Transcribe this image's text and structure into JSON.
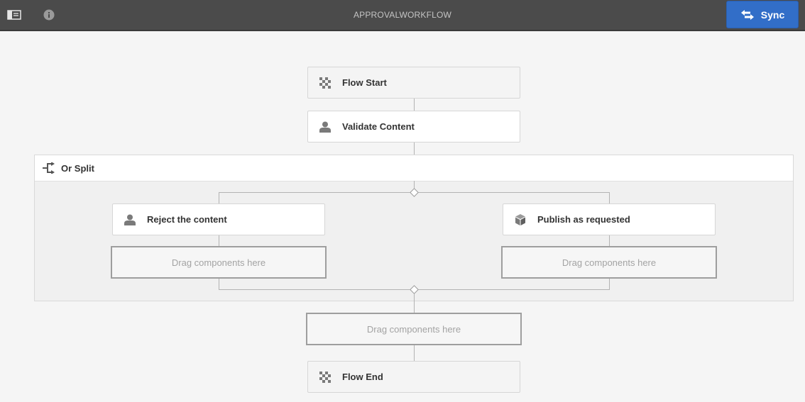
{
  "toolbar": {
    "title": "APPROVALWORKFLOW",
    "sync_label": "Sync",
    "accent_color": "#326ec8"
  },
  "icons": {
    "panel_toggle": "sidebar-toggle-icon",
    "info": "info-icon",
    "sync": "sync-arrows-icon",
    "flow_terminal": "checkered-flag-icon",
    "participant": "user-icon",
    "process": "package-icon",
    "split": "split-icon"
  },
  "workflow": {
    "flow_start": "Flow Start",
    "validate": "Validate Content",
    "or_split": {
      "label": "Or Split",
      "branch_left": {
        "step": "Reject the content",
        "drop": "Drag components here"
      },
      "branch_right": {
        "step": "Publish as requested",
        "drop": "Drag components here"
      }
    },
    "after_split_drop": "Drag components here",
    "flow_end": "Flow End"
  }
}
